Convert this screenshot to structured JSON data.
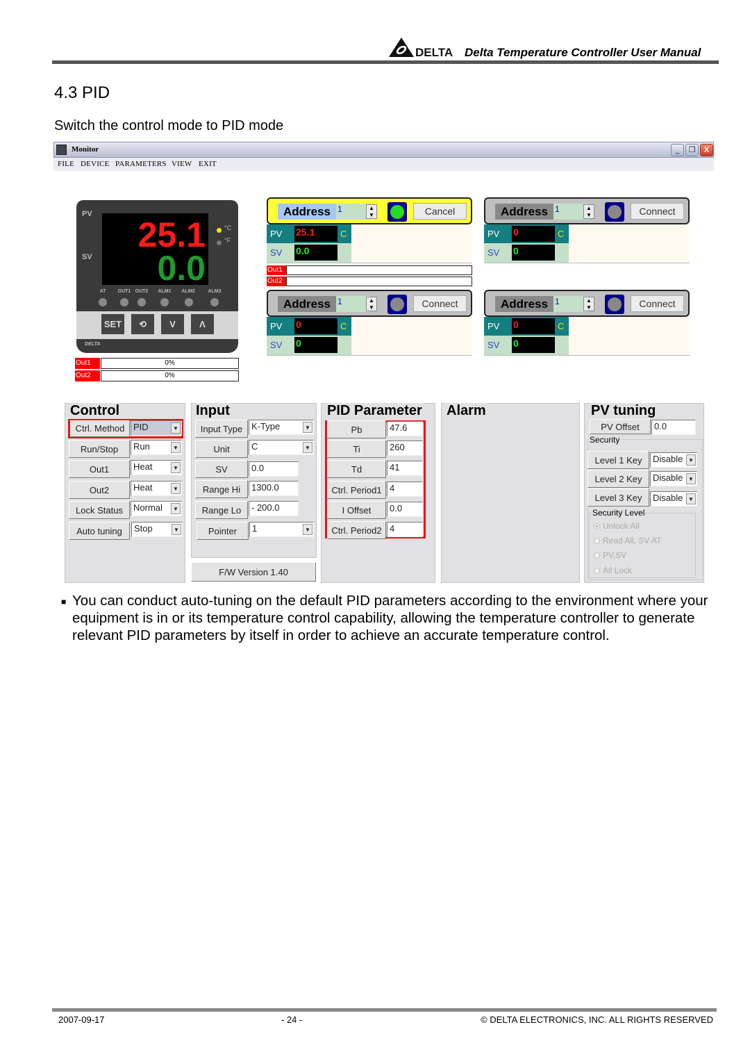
{
  "header": {
    "logo_text": "DELTA",
    "title": "Delta Temperature Controller User Manual"
  },
  "section": {
    "title": "4.3 PID",
    "intro": "Switch the control mode to PID mode"
  },
  "window": {
    "title": "Monitor",
    "menu": [
      "FILE",
      "DEVICE",
      "PARAMETERS",
      "VIEW",
      "EXIT"
    ],
    "controls": {
      "minimize": "_",
      "restore": "❐",
      "close": "X"
    }
  },
  "device": {
    "pv_label": "PV",
    "sv_label": "SV",
    "pv_value": "25.1",
    "sv_value": "0.0",
    "unit_c": "°C",
    "unit_f": "°F",
    "active_unit": "C",
    "leds": [
      "AT",
      "OUT1",
      "OUT2",
      "ALM1",
      "ALM2",
      "ALM3"
    ],
    "keys": {
      "set": "SET",
      "cycle": "⟲",
      "down": "V",
      "up": "Λ"
    },
    "brand": "DELTA",
    "outputs": [
      {
        "label": "Out1",
        "value": "0%"
      },
      {
        "label": "Out2",
        "value": "0%"
      }
    ]
  },
  "nodes": [
    {
      "address_label": "Address",
      "address": "1",
      "button": "Cancel",
      "connected": true,
      "pv_label": "PV",
      "sv_label": "SV",
      "pv": "25.1",
      "sv": "0.0",
      "unit": "C",
      "outputs": [
        "Out1",
        "Out2"
      ]
    },
    {
      "address_label": "Address",
      "address": "1",
      "button": "Connect",
      "connected": false,
      "pv_label": "PV",
      "sv_label": "SV",
      "pv": "0",
      "sv": "0",
      "unit": "C"
    },
    {
      "address_label": "Address",
      "address": "1",
      "button": "Connect",
      "connected": false,
      "pv_label": "PV",
      "sv_label": "SV",
      "pv": "0",
      "sv": "0",
      "unit": "C"
    },
    {
      "address_label": "Address",
      "address": "1",
      "button": "Connect",
      "connected": false,
      "pv_label": "PV",
      "sv_label": "SV",
      "pv": "0",
      "sv": "0",
      "unit": "C"
    }
  ],
  "colors": {
    "led_on": "#22dd22",
    "led_off": "#888888",
    "highlight": "#ee1111"
  },
  "control": {
    "title": "Control",
    "rows": [
      {
        "label": "Ctrl. Method",
        "value": "PID",
        "highlighted": true
      },
      {
        "label": "Run/Stop",
        "value": "Run"
      },
      {
        "label": "Out1",
        "value": "Heat"
      },
      {
        "label": "Out2",
        "value": "Heat"
      },
      {
        "label": "Lock Status",
        "value": "Normal"
      },
      {
        "label": "Auto tuning",
        "value": "Stop"
      }
    ]
  },
  "input": {
    "title": "Input",
    "rows": [
      {
        "label": "Input Type",
        "value": "K-Type",
        "type": "select"
      },
      {
        "label": "Unit",
        "value": "C",
        "type": "select"
      },
      {
        "label": "SV",
        "value": "0.0",
        "type": "text"
      },
      {
        "label": "Range Hi",
        "value": "1300.0",
        "type": "text"
      },
      {
        "label": "Range Lo",
        "value": "- 200.0",
        "type": "text"
      },
      {
        "label": "Pointer",
        "value": "1",
        "type": "select"
      }
    ],
    "firmware": "F/W Version 1.40"
  },
  "pid": {
    "title": "PID Parameter",
    "rows": [
      {
        "label": "Pb",
        "value": "47.6"
      },
      {
        "label": "Ti",
        "value": "260"
      },
      {
        "label": "Td",
        "value": "41"
      },
      {
        "label": "Ctrl. Period1",
        "value": "4"
      },
      {
        "label": "I Offset",
        "value": "0.0"
      },
      {
        "label": "Ctrl. Period2",
        "value": "4"
      }
    ]
  },
  "alarm": {
    "title": "Alarm"
  },
  "pv_tuning": {
    "title": "PV tuning",
    "pv_offset_label": "PV Offset",
    "pv_offset_value": "0.0",
    "security_label": "Security",
    "keys": [
      {
        "label": "Level 1 Key",
        "value": "Disable"
      },
      {
        "label": "Level 2 Key",
        "value": "Disable"
      },
      {
        "label": "Level 3 Key",
        "value": "Disable"
      }
    ],
    "security_level_label": "Security Level",
    "security_levels": [
      {
        "label": "Unlock All",
        "selected": true
      },
      {
        "label": "Read All, SV AT",
        "selected": false
      },
      {
        "label": "PV,SV",
        "selected": false
      },
      {
        "label": "All Lock",
        "selected": false
      }
    ]
  },
  "body": {
    "bullet": "■",
    "paragraph": "You can conduct auto-tuning on the default PID parameters according to the environment where your equipment is in or its temperature control capability, allowing the temperature controller to generate relevant PID parameters by itself in order to achieve an accurate temperature control."
  },
  "footer": {
    "date": "2007-09-17",
    "page": "- 24 -",
    "copyright": "© DELTA ELECTRONICS, INC. ALL RIGHTS RESERVED"
  }
}
